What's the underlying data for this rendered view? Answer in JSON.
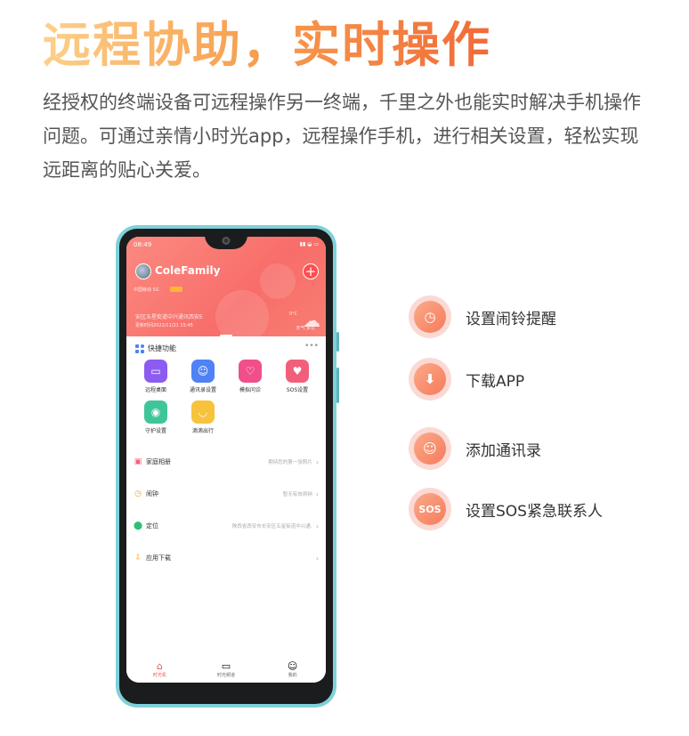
{
  "headline": "远程协助，实时操作",
  "intro": "经授权的终端设备可远程操作另一终端，千里之外也能实时解决手机操作问题。可通过亲情小时光app，远程操作手机，进行相关设置，轻松实现远距离的贴心关爱。",
  "phone": {
    "status_time": "08:49",
    "status_right": "▮▮ ◒ ▭",
    "family_name": "ColeFamily",
    "add_symbol": "+",
    "member_line": "中国移动 5G",
    "address_line": "安区五星街道中兴通讯西安E",
    "update_line": "更新时间2022/11/21 15:45",
    "temp_line": "0°C",
    "weather_line": "天气 多云",
    "quick_title": "快捷功能",
    "more_dots": "•••",
    "apps": [
      {
        "label": "远程桌面",
        "icon": "tablet-icon",
        "glyph": "▭",
        "color": "#8c5cf0"
      },
      {
        "label": "通讯录设置",
        "icon": "contacts-icon",
        "glyph": "☺",
        "color": "#4f82f6"
      },
      {
        "label": "模拟问诊",
        "icon": "stethoscope-icon",
        "glyph": "♡",
        "color": "#f04f8a"
      },
      {
        "label": "SOS设置",
        "icon": "heart-icon",
        "glyph": "♥",
        "color": "#f25f7a"
      },
      {
        "label": "守护设置",
        "icon": "guard-icon",
        "glyph": "◉",
        "color": "#3fc59a"
      },
      {
        "label": "滴滴出行",
        "icon": "didi-icon",
        "glyph": "◡",
        "color": "#f7c23c"
      }
    ],
    "rows": [
      {
        "label": "家庭相册",
        "value": "期待您的第一张照片",
        "icon": "album-icon",
        "glyph": "▣",
        "color": "#f25f7a"
      },
      {
        "label": "闹钟",
        "value": "暂无有效闹钟",
        "icon": "alarm-icon",
        "glyph": "◷",
        "color": "#f5a623"
      },
      {
        "label": "定位",
        "value": "陕西省西安市长安区五星街道中兴通...",
        "icon": "location-icon",
        "glyph": "⬤",
        "color": "#2fbf71"
      },
      {
        "label": "应用下载",
        "value": "",
        "icon": "download-icon",
        "glyph": "⇩",
        "color": "#f5a623"
      }
    ],
    "chevron": "›",
    "tabs": [
      {
        "label": "时光机",
        "glyph": "⌂"
      },
      {
        "label": "时光频道",
        "glyph": "▭"
      },
      {
        "label": "我的",
        "glyph": "☺"
      }
    ]
  },
  "features": [
    {
      "label": "设置闹铃提醒",
      "icon": "alarm-clock-icon",
      "glyph": "◷"
    },
    {
      "label": "下载APP",
      "icon": "download-arrow-icon",
      "glyph": "⬇"
    },
    {
      "label": "添加通讯录",
      "icon": "contact-book-icon",
      "glyph": "☺"
    },
    {
      "label": "设置SOS紧急联系人",
      "icon": "sos-icon",
      "glyph": "SOS"
    }
  ]
}
